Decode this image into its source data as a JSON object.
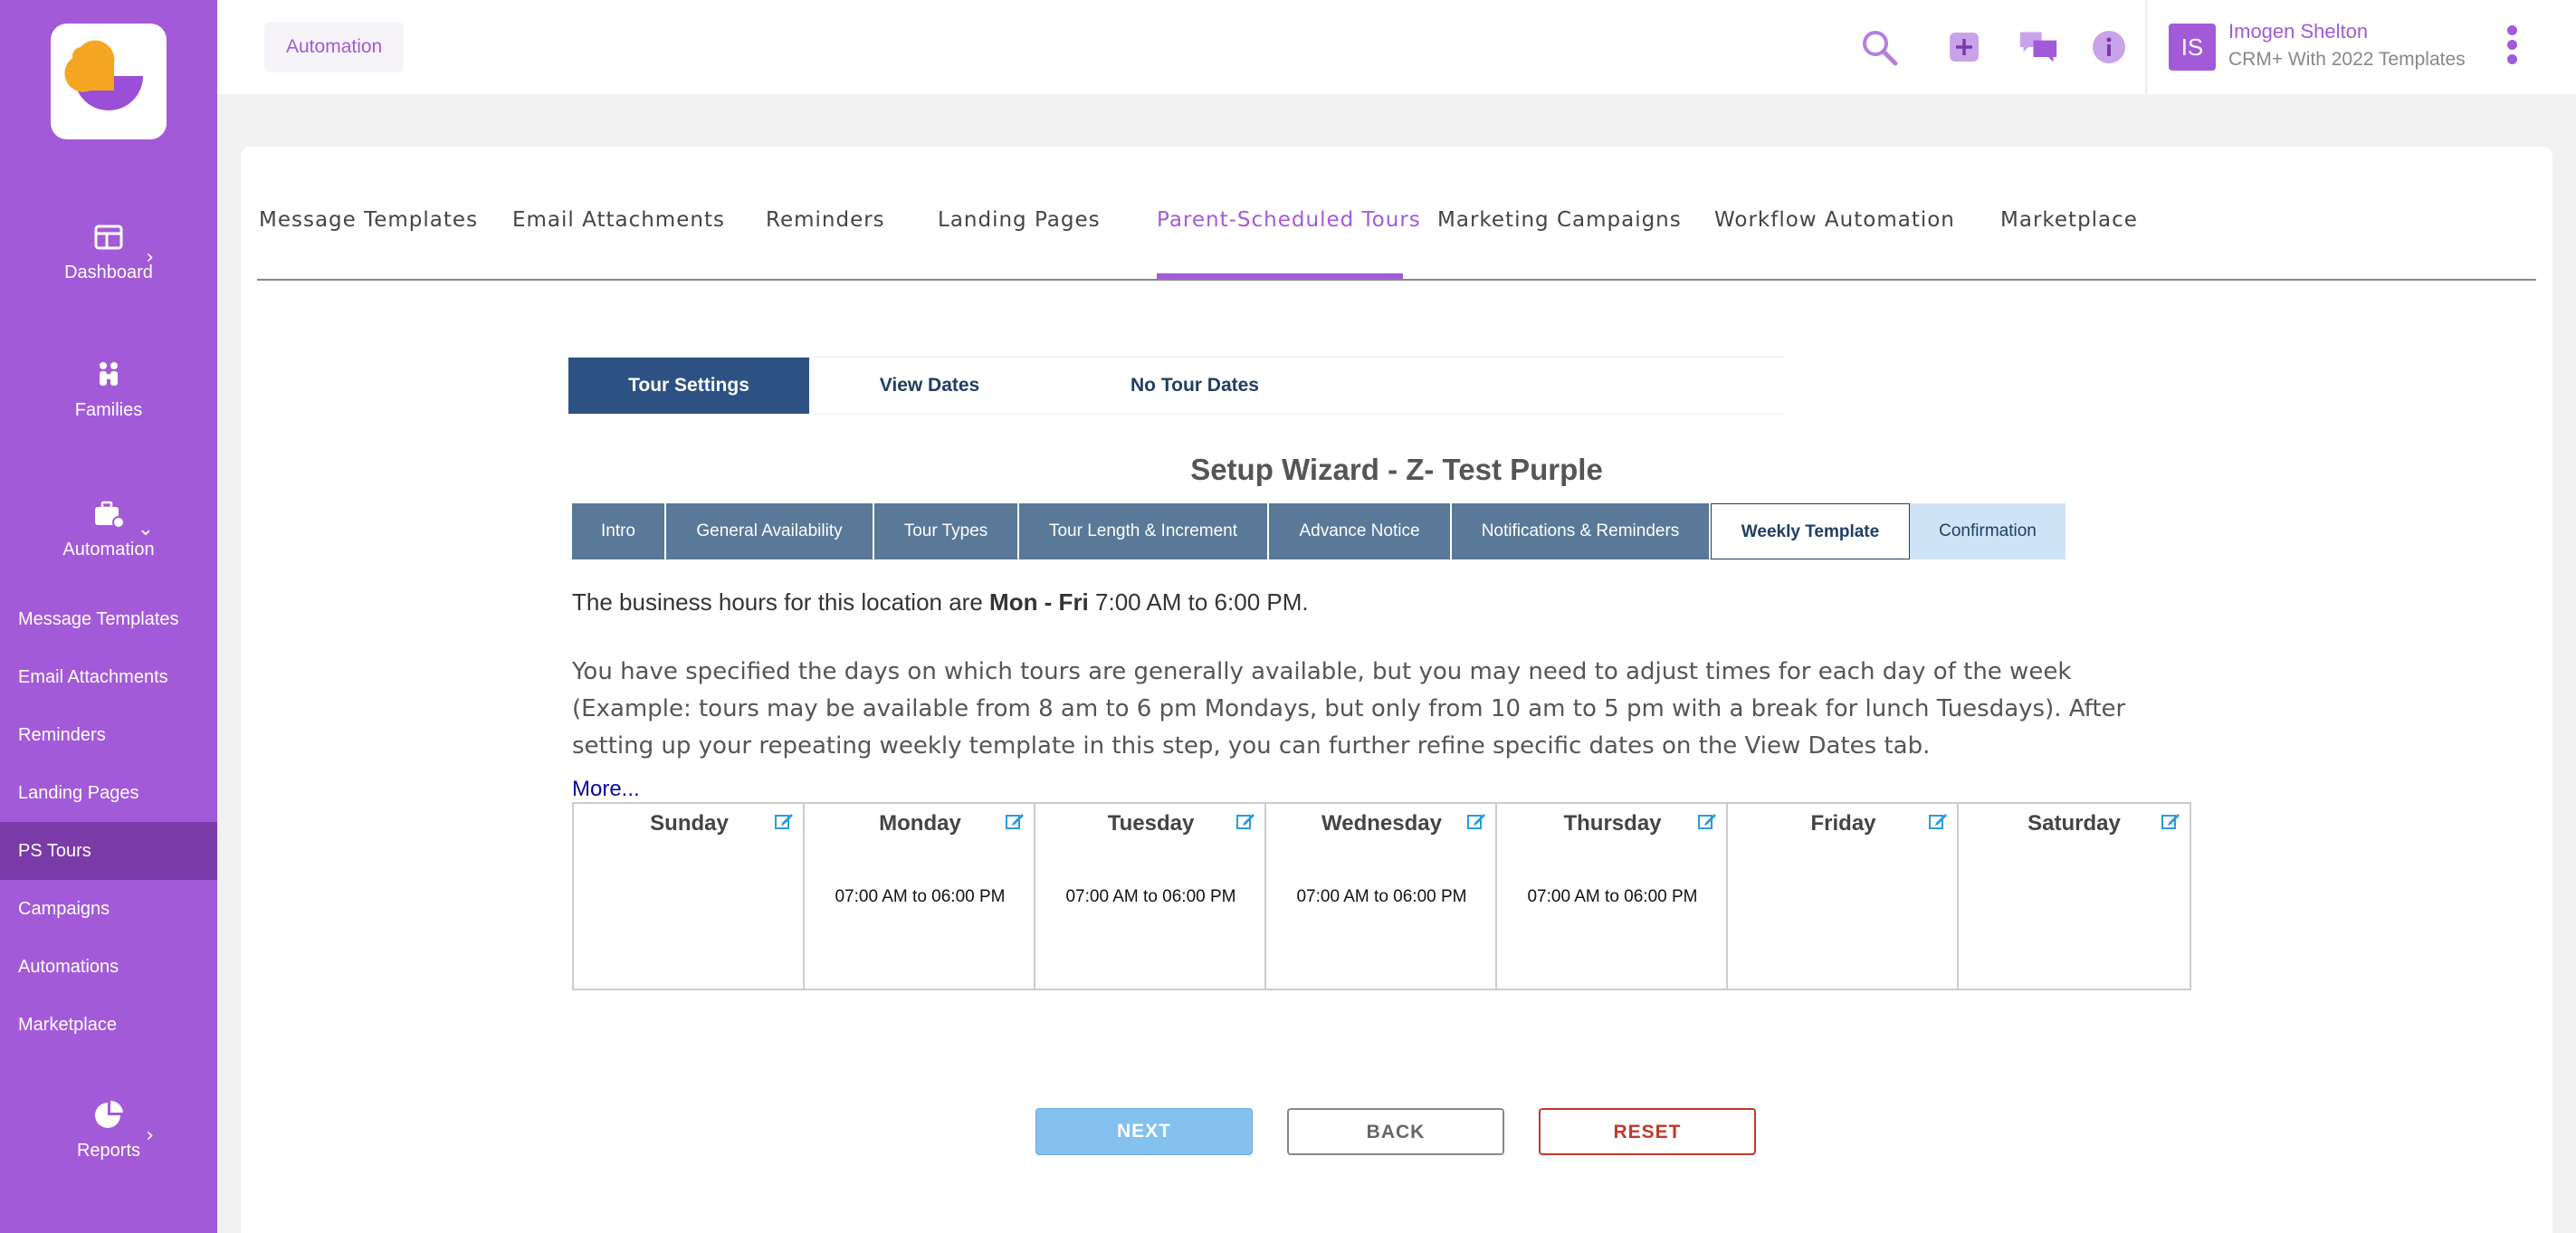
{
  "sidebar": {
    "dashboard": "Dashboard",
    "families": "Families",
    "automation": "Automation",
    "links": [
      "Message Templates",
      "Email Attachments",
      "Reminders",
      "Landing Pages",
      "PS Tours",
      "Campaigns",
      "Automations",
      "Marketplace"
    ],
    "reports": "Reports"
  },
  "header": {
    "breadcrumb": "Automation",
    "user_initials": "IS",
    "user_name": "Imogen Shelton",
    "user_plan": "CRM+ With 2022 Templates"
  },
  "tabs": [
    "Message Templates",
    "Email Attachments",
    "Reminders",
    "Landing Pages",
    "Parent-Scheduled Tours",
    "Marketing Campaigns",
    "Workflow Automation",
    "Marketplace"
  ],
  "subtabs": [
    "Tour Settings",
    "View Dates",
    "No Tour Dates"
  ],
  "wizard": {
    "title": "Setup Wizard - Z- Test Purple",
    "steps": [
      "Intro",
      "General Availability",
      "Tour Types",
      "Tour Length & Increment",
      "Advance Notice",
      "Notifications & Reminders",
      "Weekly Template",
      "Confirmation"
    ],
    "biz_prefix": "The business hours for this location are ",
    "biz_days": "Mon - Fri",
    "biz_hours": " 7:00 AM to 6:00 PM.",
    "description": "You have specified the days on which tours are generally available, but you may need to adjust times for each day of the week (Example: tours may be available from 8 am to 6 pm Mondays, but only from 10 am to 5 pm with a break for lunch Tuesdays). After setting up your repeating weekly template in this step, you can further refine specific dates on the View Dates tab.",
    "more": "More..."
  },
  "week": [
    {
      "day": "Sunday",
      "hours": ""
    },
    {
      "day": "Monday",
      "hours": "07:00 AM to 06:00 PM"
    },
    {
      "day": "Tuesday",
      "hours": "07:00 AM to 06:00 PM"
    },
    {
      "day": "Wednesday",
      "hours": "07:00 AM to 06:00 PM"
    },
    {
      "day": "Thursday",
      "hours": "07:00 AM to 06:00 PM"
    },
    {
      "day": "Friday",
      "hours": ""
    },
    {
      "day": "Saturday",
      "hours": ""
    }
  ],
  "buttons": {
    "next": "NEXT",
    "back": "BACK",
    "reset": "RESET"
  },
  "colors": {
    "brand": "#a35ad8",
    "sidebar_active": "#7a3aa8",
    "subtab_active": "#2d5183",
    "step": "#5a7898",
    "next_btn": "#85c1ef",
    "reset": "#c0392b"
  }
}
